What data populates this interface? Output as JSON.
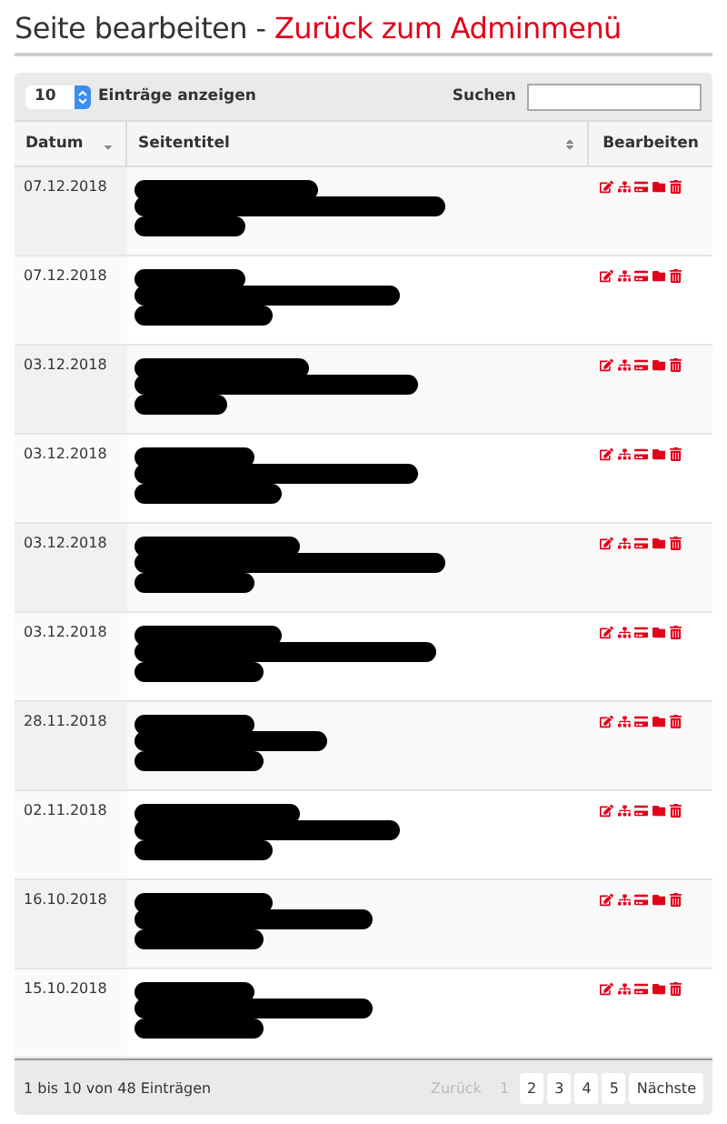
{
  "heading": {
    "title": "Seite bearbeiten",
    "separator": "-",
    "link": "Zurück zum Adminmenü"
  },
  "toolbar": {
    "page_size": "10",
    "page_size_label": "Einträge anzeigen",
    "search_label": "Suchen"
  },
  "table": {
    "columns": [
      {
        "label": "Datum",
        "sortable": true,
        "sorted": true
      },
      {
        "label": "Seitentitel",
        "sortable": true,
        "sorted": false
      },
      {
        "label": "Bearbeiten",
        "sortable": false
      }
    ],
    "rows": [
      {
        "date": "07.12.2018",
        "title_redacted": true
      },
      {
        "date": "07.12.2018",
        "title_redacted": true
      },
      {
        "date": "03.12.2018",
        "title_redacted": true
      },
      {
        "date": "03.12.2018",
        "title_redacted": true
      },
      {
        "date": "03.12.2018",
        "title_redacted": true
      },
      {
        "date": "03.12.2018",
        "title_redacted": true
      },
      {
        "date": "28.11.2018",
        "title_redacted": true
      },
      {
        "date": "02.11.2018",
        "title_redacted": true
      },
      {
        "date": "16.10.2018",
        "title_redacted": true
      },
      {
        "date": "15.10.2018",
        "title_redacted": true
      }
    ]
  },
  "footer": {
    "info": "1 bis 10 von 48 Einträgen",
    "previous": {
      "label": "Zurück",
      "disabled": true
    },
    "pages": [
      {
        "label": "1",
        "selected": true
      },
      {
        "label": "2",
        "selected": false
      },
      {
        "label": "3",
        "selected": false
      },
      {
        "label": "4",
        "selected": false
      },
      {
        "label": "5",
        "selected": false
      }
    ],
    "next": {
      "label": "Nächste",
      "disabled": false
    }
  }
}
